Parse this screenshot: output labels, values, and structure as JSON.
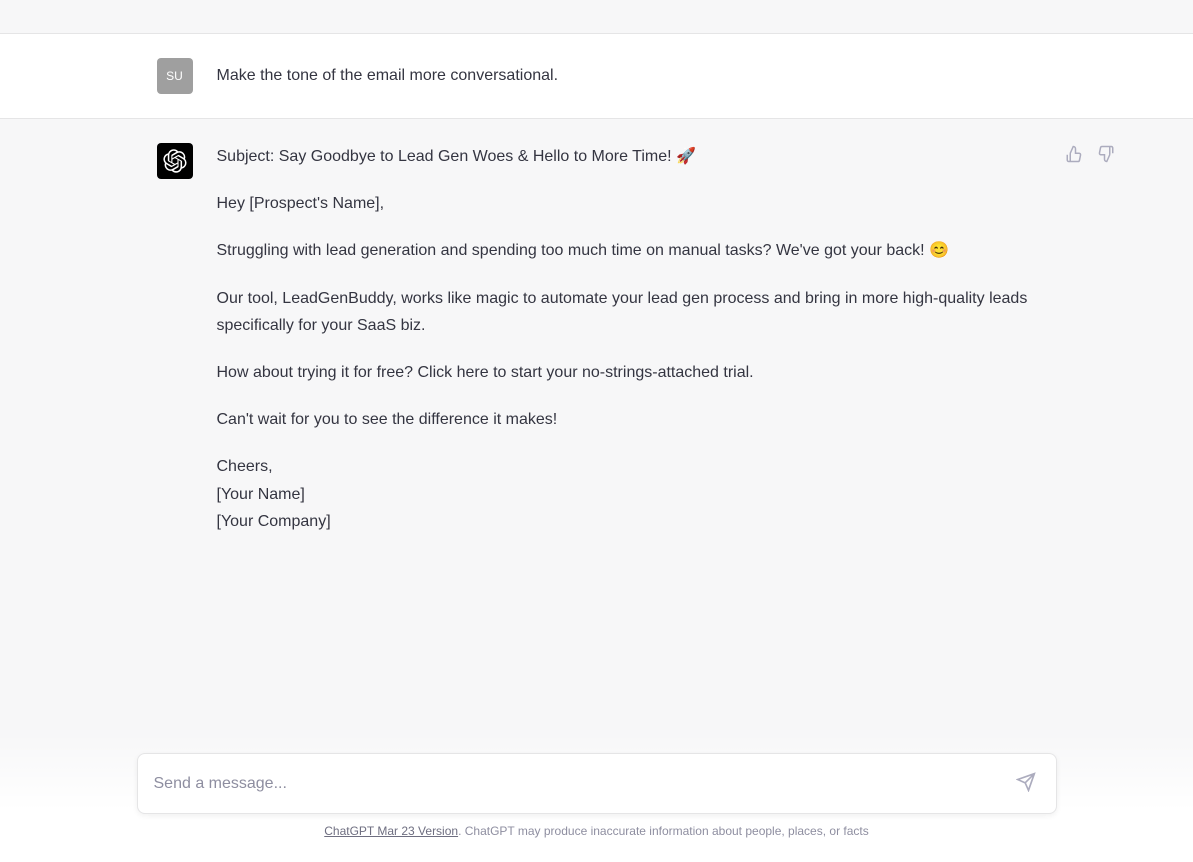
{
  "user": {
    "avatar_initials": "SU",
    "message": "Make the tone of the email more conversational."
  },
  "assistant": {
    "para1": "Subject: Say Goodbye to Lead Gen Woes & Hello to More Time! 🚀",
    "para2": "Hey [Prospect's Name],",
    "para3": "Struggling with lead generation and spending too much time on manual tasks? We've got your back! 😊",
    "para4": "Our tool, LeadGenBuddy, works like magic to automate your lead gen process and bring in more high-quality leads specifically for your SaaS biz.",
    "para5": "How about trying it for free? Click here to start your no-strings-attached trial.",
    "para6": "Can't wait for you to see the difference it makes!",
    "sig1": "Cheers,",
    "sig2": "[Your Name]",
    "sig3": "[Your Company]"
  },
  "compose": {
    "placeholder": "Send a message..."
  },
  "footer": {
    "version": "ChatGPT Mar 23 Version",
    "disclaimer": ". ChatGPT may produce inaccurate information about people, places, or facts"
  }
}
